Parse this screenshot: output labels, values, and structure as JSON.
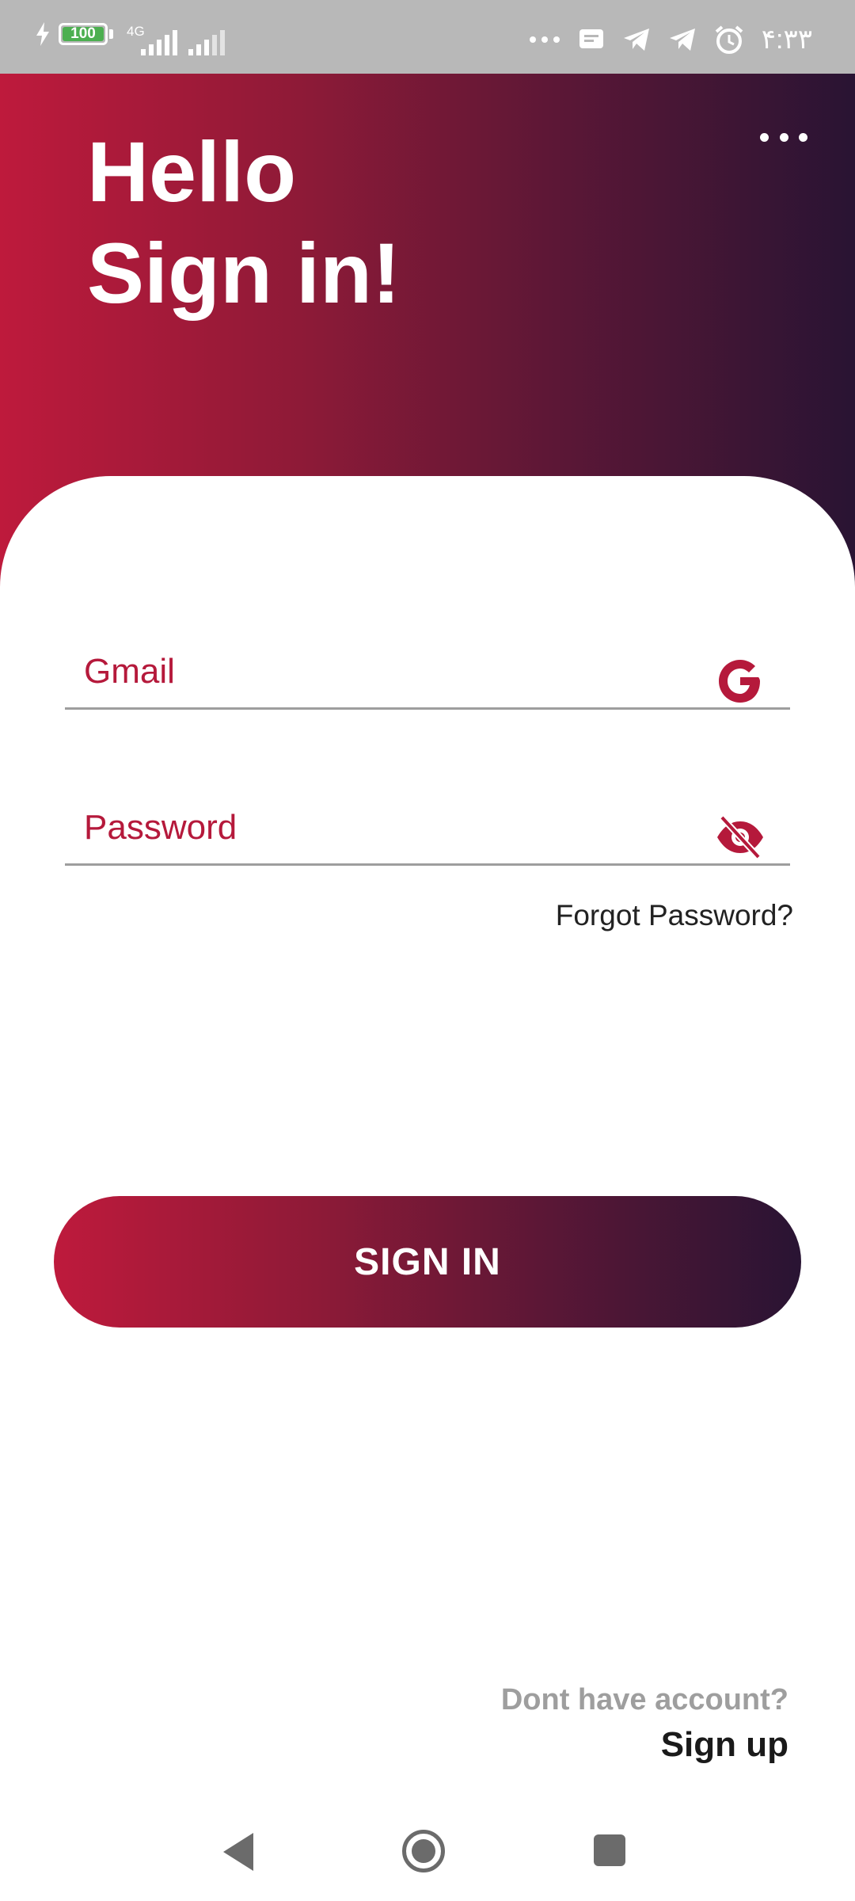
{
  "status_bar": {
    "battery_level": "100",
    "battery_fraction": 1.0,
    "network_label": "4G",
    "time": "۴:۳۳",
    "icons": [
      "charging-bolt-icon",
      "battery-icon",
      "signal-icon",
      "signal-icon",
      "more-notifications-icon",
      "message-icon",
      "telegram-icon",
      "telegram-icon",
      "alarm-icon"
    ]
  },
  "header": {
    "title_line1": "Hello",
    "title_line2": "Sign in!",
    "menu_icon": "more-horizontal-icon"
  },
  "form": {
    "email": {
      "label": "Gmail",
      "icon": "google-icon"
    },
    "password": {
      "label": "Password",
      "icon": "eye-off-icon"
    },
    "forgot_label": "Forgot Password?",
    "submit_label": "SIGN IN"
  },
  "footer": {
    "prompt": "Dont have account?",
    "signup_label": "Sign up"
  },
  "navigation": {
    "icons": [
      "back-icon",
      "home-icon",
      "recents-icon"
    ]
  },
  "colors": {
    "accent": "#b5193b",
    "gradient_start": "#be1a3c",
    "gradient_end": "#291433",
    "muted_text": "#9e9e9e"
  }
}
